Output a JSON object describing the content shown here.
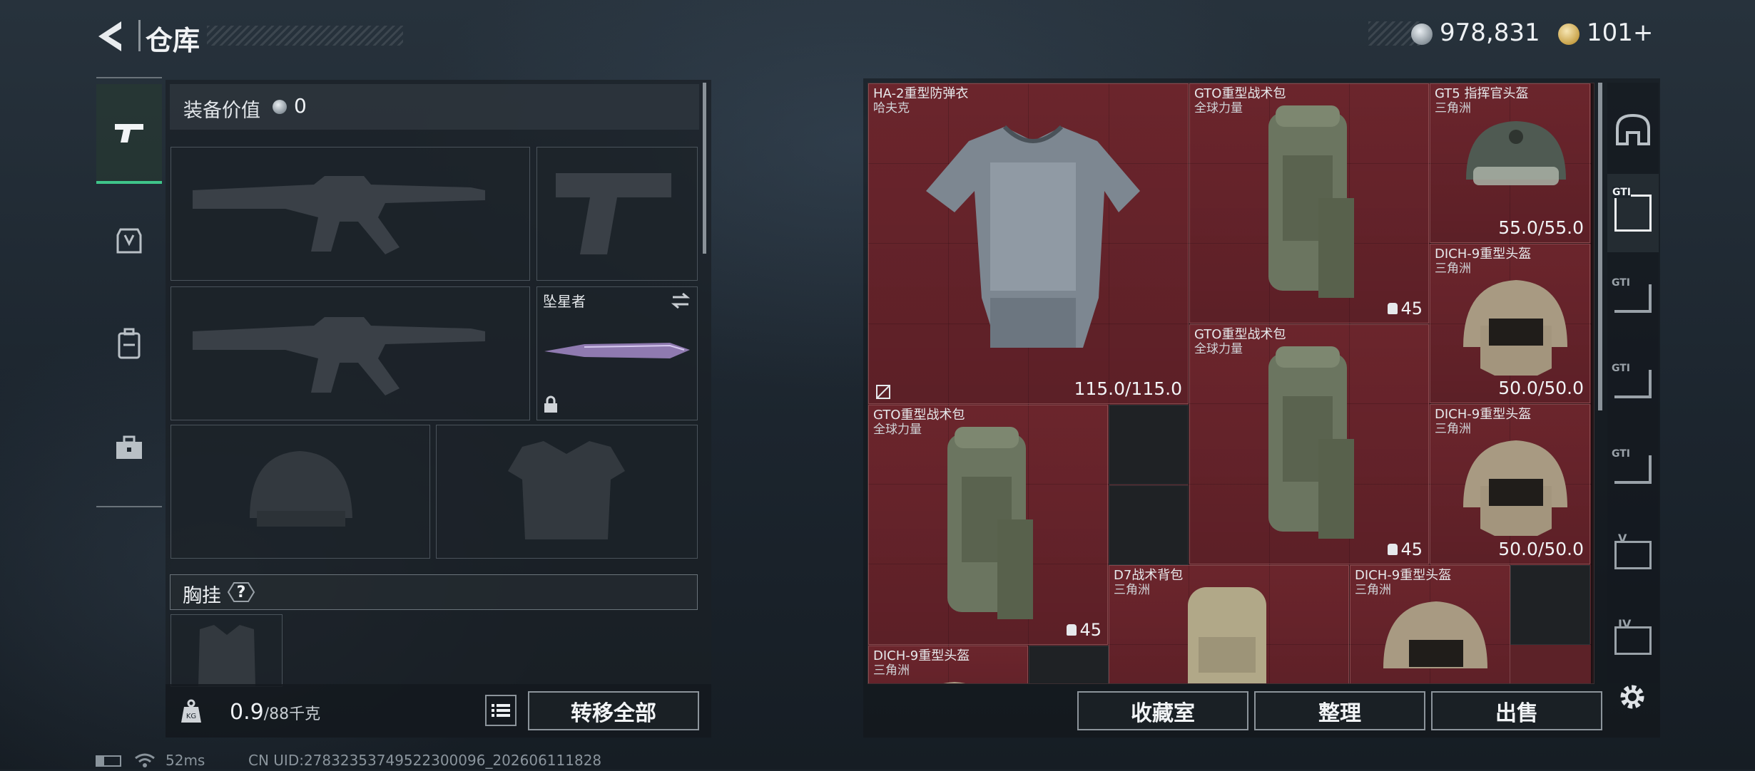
{
  "header": {
    "title": "仓库",
    "currency_silver": "978,831",
    "currency_gold": "101+"
  },
  "loadout": {
    "value_label": "装备价值",
    "value": "0",
    "melee_name": "坠星者",
    "chest_label": "胸挂",
    "help": "?",
    "weight_current": "0.9",
    "weight_max": "/88千克",
    "transfer_all": "转移全部"
  },
  "stash": {
    "items": [
      {
        "name": "HA-2重型防弹衣",
        "sub": "哈夫克",
        "durability": "115.0/115.0"
      },
      {
        "name": "GTO重型战术包",
        "sub": "全球力量",
        "count": "45"
      },
      {
        "name": "GT5 指挥官头盔",
        "sub": "三角洲",
        "durability": "55.0/55.0"
      },
      {
        "name": "DICH-9重型头盔",
        "sub": "三角洲",
        "durability": "50.0/50.0"
      },
      {
        "name": "GTO重型战术包",
        "sub": "全球力量",
        "count": "45"
      },
      {
        "name": "GTO重型战术包",
        "sub": "全球力量",
        "count": "45"
      },
      {
        "name": "DICH-9重型头盔",
        "sub": "三角洲",
        "durability": "50.0/50.0"
      },
      {
        "name": "D7战术背包",
        "sub": "三角洲"
      },
      {
        "name": "DICH-9重型头盔",
        "sub": "三角洲"
      },
      {
        "name": "DICH-9重型头盔",
        "sub": "三角洲"
      }
    ],
    "buttons": {
      "collection": "收藏室",
      "sort": "整理",
      "sell": "出售"
    }
  },
  "right_categories": [
    {
      "icon": "bunker-icon"
    },
    {
      "icon": "stash-1-icon",
      "label": "GTI"
    },
    {
      "icon": "stash-2-icon",
      "label": "GTI"
    },
    {
      "icon": "stash-3-icon",
      "label": "GTI"
    },
    {
      "icon": "stash-4-icon",
      "label": "GTI"
    },
    {
      "icon": "stash-5-icon",
      "label": "V"
    },
    {
      "icon": "stash-6-icon",
      "label": "IV"
    }
  ],
  "status": {
    "ping": "52ms",
    "uid": "CN UID:27832353749522300096_202606111828"
  },
  "colors": {
    "stash_cell": "#5c2228",
    "accent_green": "#3fc58a"
  }
}
